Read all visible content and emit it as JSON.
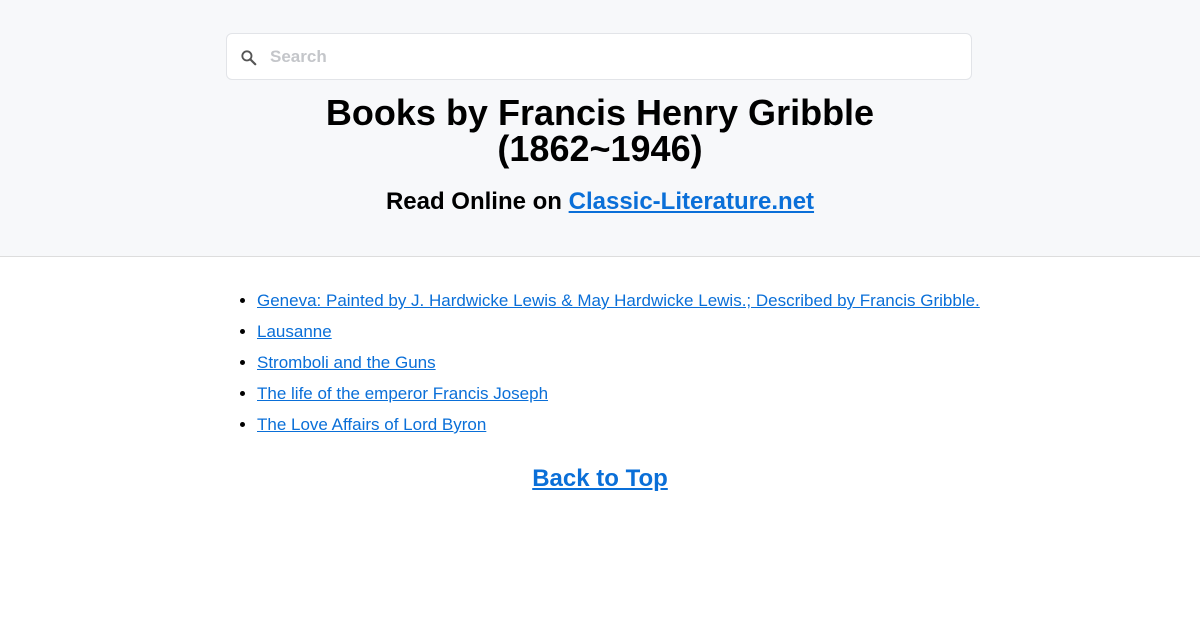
{
  "search": {
    "placeholder": "Search",
    "icon": "search-icon"
  },
  "header": {
    "title_line1": "Books by Francis Henry Gribble",
    "title_line2": "(1862~1946)",
    "subtitle_prefix": "Read Online on ",
    "site_link": "Classic-Literature.net"
  },
  "books": [
    "Geneva: Painted by J. Hardwicke Lewis & May Hardwicke Lewis.; Described by Francis Gribble.",
    "Lausanne",
    "Stromboli and the Guns",
    "The life of the emperor Francis Joseph",
    "The Love Affairs of Lord Byron"
  ],
  "back_to_top": "Back to Top",
  "colors": {
    "link": "#0a6fd8",
    "header_bg": "#f7f8fa"
  }
}
